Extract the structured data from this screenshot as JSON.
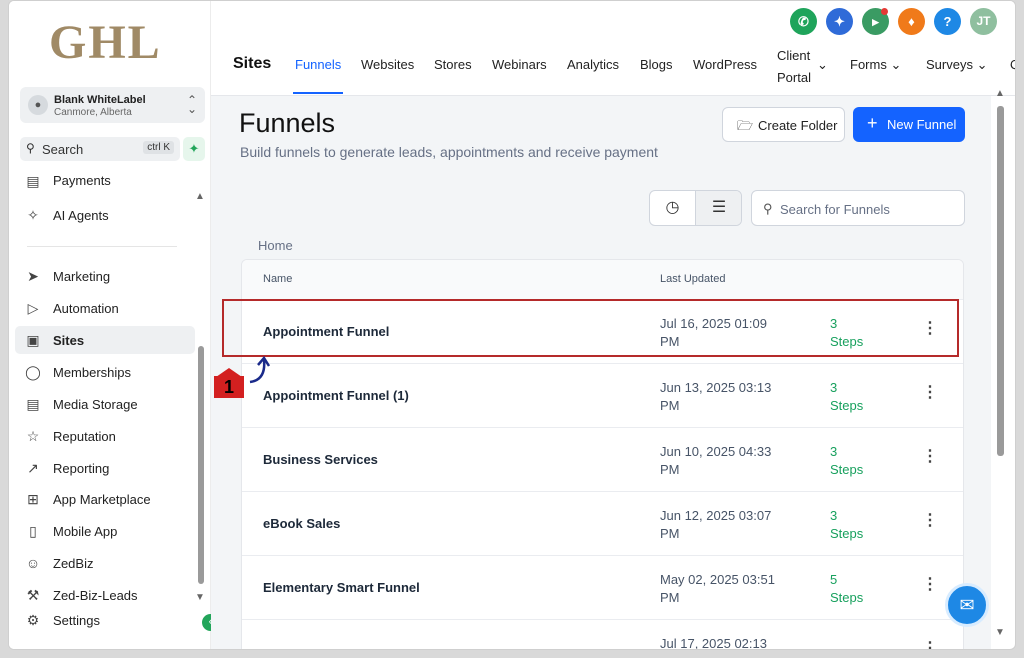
{
  "sidebar": {
    "logo": "GHL",
    "account": {
      "name": "Blank WhiteLabel",
      "location": "Canmore, Alberta"
    },
    "search": {
      "label": "Search",
      "shortcut": "ctrl K"
    },
    "items": [
      {
        "label": "Payments",
        "icon": "payments-icon"
      },
      {
        "label": "AI Agents",
        "icon": "sparkle-icon"
      },
      {
        "label": "Marketing",
        "icon": "send-icon"
      },
      {
        "label": "Automation",
        "icon": "automation-icon"
      },
      {
        "label": "Sites",
        "icon": "sites-icon",
        "active": true
      },
      {
        "label": "Memberships",
        "icon": "award-icon"
      },
      {
        "label": "Media Storage",
        "icon": "image-icon"
      },
      {
        "label": "Reputation",
        "icon": "star-icon"
      },
      {
        "label": "Reporting",
        "icon": "trend-icon"
      },
      {
        "label": "App Marketplace",
        "icon": "grid-icon"
      },
      {
        "label": "Mobile App",
        "icon": "phone-icon"
      },
      {
        "label": "ZedBiz",
        "icon": "bot-icon"
      },
      {
        "label": "Zed-Biz-Leads",
        "icon": "wrench-icon"
      },
      {
        "label": "Settings",
        "icon": "gear-icon"
      }
    ]
  },
  "header": {
    "title": "Sites",
    "tabs": [
      "Funnels",
      "Websites",
      "Stores",
      "Webinars",
      "Analytics",
      "Blogs",
      "WordPress"
    ],
    "client_portal": [
      "Client",
      "Portal"
    ],
    "forms": "Forms",
    "surveys": "Surveys",
    "more": "Q",
    "avatar_initials": "JT",
    "icon_colors": {
      "phone": "#1fa45b",
      "sparkle": "#2f6bd8",
      "megaphone": "#3a9b63",
      "bell": "#f07a1a",
      "help": "#1e88e5",
      "avatar": "#8fbf9f"
    }
  },
  "main": {
    "title": "Funnels",
    "subtitle": "Build funnels to generate leads, appointments and receive payment",
    "create_folder": "Create Folder",
    "new_funnel": "New Funnel",
    "search_placeholder": "Search for Funnels",
    "breadcrumb": "Home",
    "columns": {
      "name": "Name",
      "updated": "Last Updated"
    },
    "rows": [
      {
        "name": "Appointment Funnel",
        "date1": "Jul 16, 2025 01:09",
        "date2": "PM",
        "steps1": "3",
        "steps2": "Steps"
      },
      {
        "name": "Appointment Funnel (1)",
        "date1": "Jun 13, 2025 03:13",
        "date2": "PM",
        "steps1": "3",
        "steps2": "Steps"
      },
      {
        "name": "Business Services",
        "date1": "Jun 10, 2025 04:33",
        "date2": "PM",
        "steps1": "3",
        "steps2": "Steps"
      },
      {
        "name": "eBook Sales",
        "date1": "Jun 12, 2025 03:07",
        "date2": "PM",
        "steps1": "3",
        "steps2": "Steps"
      },
      {
        "name": "Elementary Smart Funnel",
        "date1": "May 02, 2025 03:51",
        "date2": "PM",
        "steps1": "5",
        "steps2": "Steps"
      },
      {
        "name": "",
        "date1": "Jul 17, 2025 02:13",
        "date2": "",
        "steps1": "",
        "steps2": ""
      }
    ]
  },
  "annotation": {
    "step_number": "1",
    "highlight_color": "#b52a2a"
  }
}
